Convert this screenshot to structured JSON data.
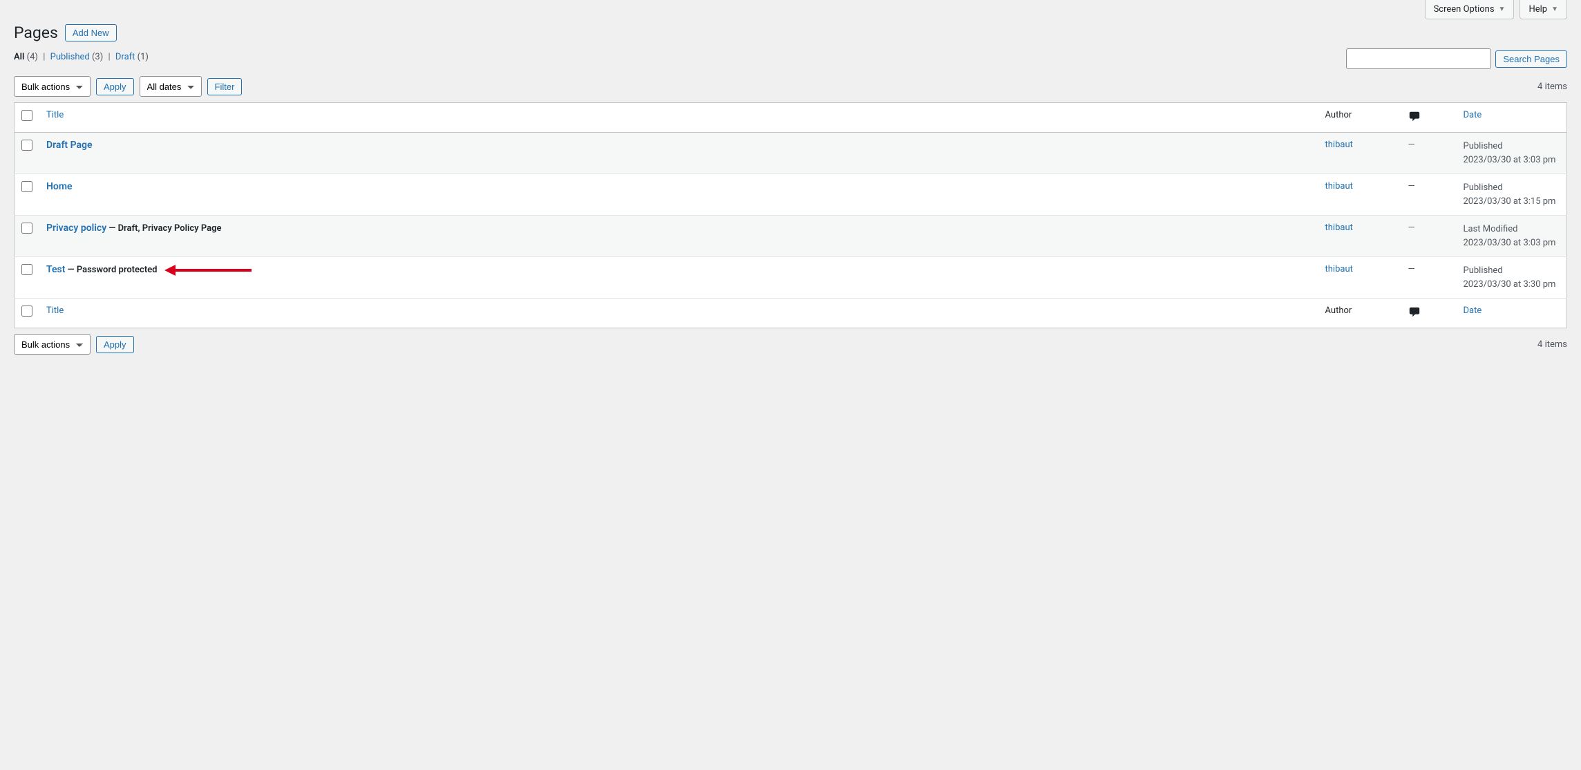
{
  "top_tabs": {
    "screen_options": "Screen Options",
    "help": "Help"
  },
  "heading": {
    "title": "Pages",
    "add_new": "Add New"
  },
  "views": {
    "all_label": "All",
    "all_count": "(4)",
    "published_label": "Published",
    "published_count": "(3)",
    "draft_label": "Draft",
    "draft_count": "(1)"
  },
  "search": {
    "button": "Search Pages"
  },
  "bulk": {
    "placeholder": "Bulk actions",
    "apply": "Apply"
  },
  "datefilter": {
    "placeholder": "All dates",
    "filter": "Filter"
  },
  "pagination": {
    "items": "4 items"
  },
  "columns": {
    "title": "Title",
    "author": "Author",
    "date": "Date"
  },
  "rows": [
    {
      "title": "Draft Page",
      "state": "",
      "author": "thibaut",
      "comments": "—",
      "date_status": "Published",
      "date_value": "2023/03/30 at 3:03 pm",
      "arrow": false
    },
    {
      "title": "Home",
      "state": "",
      "author": "thibaut",
      "comments": "—",
      "date_status": "Published",
      "date_value": "2023/03/30 at 3:15 pm",
      "arrow": false
    },
    {
      "title": "Privacy policy",
      "state": " — Draft, Privacy Policy Page",
      "author": "thibaut",
      "comments": "—",
      "date_status": "Last Modified",
      "date_value": "2023/03/30 at 3:03 pm",
      "arrow": false
    },
    {
      "title": "Test",
      "state": " — Password protected",
      "author": "thibaut",
      "comments": "—",
      "date_status": "Published",
      "date_value": "2023/03/30 at 3:30 pm",
      "arrow": true
    }
  ]
}
